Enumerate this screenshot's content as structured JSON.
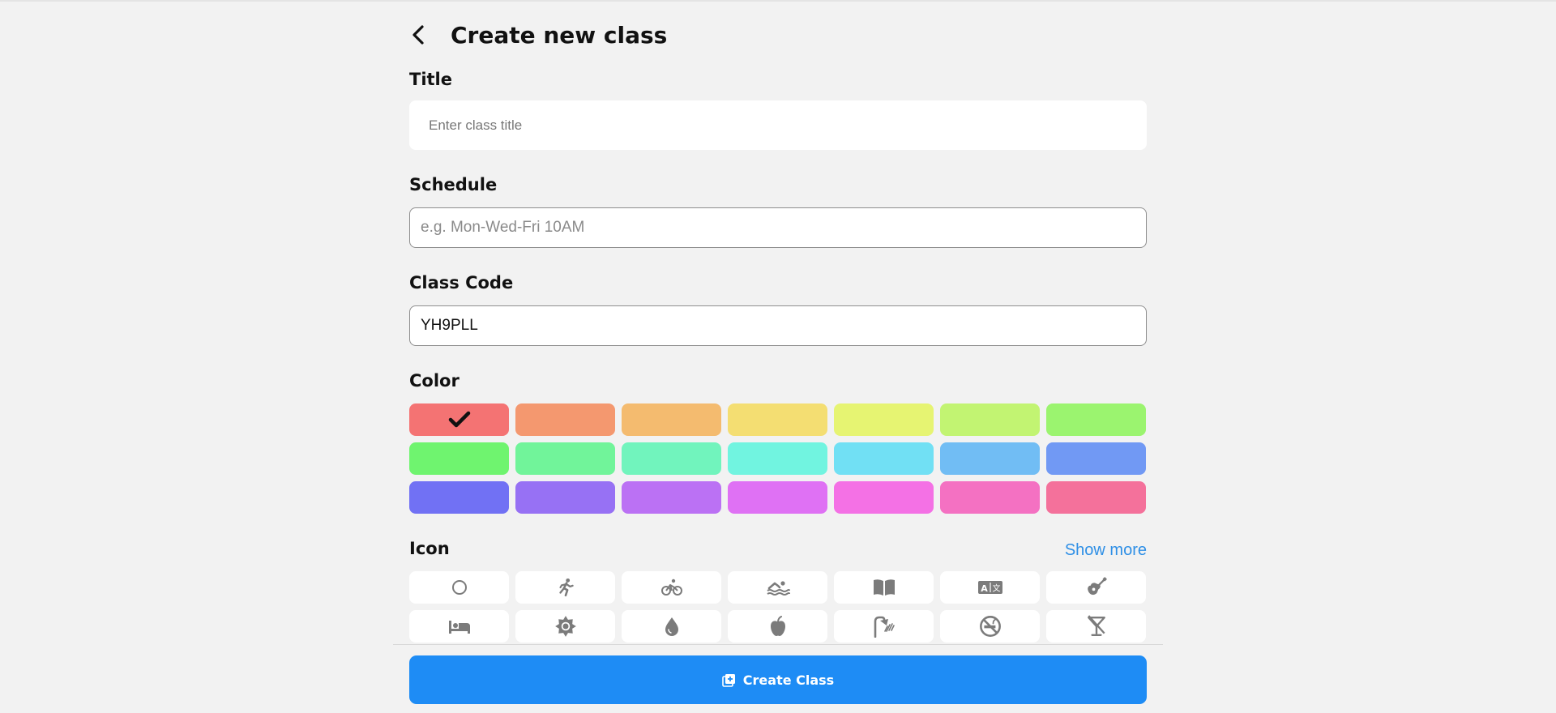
{
  "header": {
    "title": "Create new class",
    "back_icon": "chevron-left-icon"
  },
  "form": {
    "title": {
      "label": "Title",
      "placeholder": "Enter class title",
      "value": ""
    },
    "schedule": {
      "label": "Schedule",
      "placeholder": "e.g. Mon-Wed-Fri 10AM",
      "value": ""
    },
    "class_code": {
      "label": "Class Code",
      "value": "YH9PLL"
    },
    "color": {
      "label": "Color",
      "selected_index": 0,
      "selected_icon": "checkmark-icon",
      "swatches": [
        "#f47373",
        "#f4986f",
        "#f4bb6f",
        "#f4de72",
        "#e6f472",
        "#c2f472",
        "#9bf46f",
        "#6ff46f",
        "#71f49a",
        "#71f4bd",
        "#71f4e0",
        "#71e0f4",
        "#71bdf4",
        "#7199f4",
        "#7171f4",
        "#9771f4",
        "#bb71f4",
        "#df71f4",
        "#f471e5",
        "#f471c2",
        "#f4719b"
      ]
    },
    "icon": {
      "label": "Icon",
      "show_more": "Show more",
      "icons": [
        "circle-icon",
        "running-icon",
        "bicycle-icon",
        "swimming-icon",
        "book-icon",
        "translate-icon",
        "guitar-icon",
        "bed-icon",
        "sun-icon",
        "water-drop-icon",
        "apple-icon",
        "shower-icon",
        "no-smoking-icon",
        "no-drinks-icon"
      ]
    }
  },
  "footer": {
    "create_button": "Create Class",
    "create_icon": "add-box-icon"
  },
  "colors": {
    "accent": "#1e8cf5",
    "link": "#2e8fe6",
    "background": "#f2f2f2",
    "icon_gray": "#7b7b7b"
  }
}
